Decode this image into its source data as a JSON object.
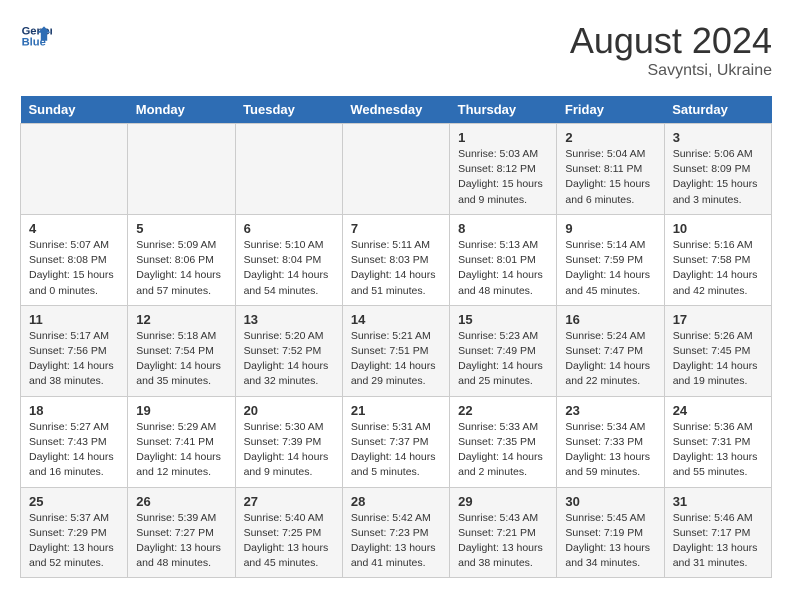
{
  "header": {
    "logo_line1": "General",
    "logo_line2": "Blue",
    "month_year": "August 2024",
    "location": "Savyntsi, Ukraine"
  },
  "weekdays": [
    "Sunday",
    "Monday",
    "Tuesday",
    "Wednesday",
    "Thursday",
    "Friday",
    "Saturday"
  ],
  "weeks": [
    [
      {
        "day": "",
        "info": ""
      },
      {
        "day": "",
        "info": ""
      },
      {
        "day": "",
        "info": ""
      },
      {
        "day": "",
        "info": ""
      },
      {
        "day": "1",
        "info": "Sunrise: 5:03 AM\nSunset: 8:12 PM\nDaylight: 15 hours\nand 9 minutes."
      },
      {
        "day": "2",
        "info": "Sunrise: 5:04 AM\nSunset: 8:11 PM\nDaylight: 15 hours\nand 6 minutes."
      },
      {
        "day": "3",
        "info": "Sunrise: 5:06 AM\nSunset: 8:09 PM\nDaylight: 15 hours\nand 3 minutes."
      }
    ],
    [
      {
        "day": "4",
        "info": "Sunrise: 5:07 AM\nSunset: 8:08 PM\nDaylight: 15 hours\nand 0 minutes."
      },
      {
        "day": "5",
        "info": "Sunrise: 5:09 AM\nSunset: 8:06 PM\nDaylight: 14 hours\nand 57 minutes."
      },
      {
        "day": "6",
        "info": "Sunrise: 5:10 AM\nSunset: 8:04 PM\nDaylight: 14 hours\nand 54 minutes."
      },
      {
        "day": "7",
        "info": "Sunrise: 5:11 AM\nSunset: 8:03 PM\nDaylight: 14 hours\nand 51 minutes."
      },
      {
        "day": "8",
        "info": "Sunrise: 5:13 AM\nSunset: 8:01 PM\nDaylight: 14 hours\nand 48 minutes."
      },
      {
        "day": "9",
        "info": "Sunrise: 5:14 AM\nSunset: 7:59 PM\nDaylight: 14 hours\nand 45 minutes."
      },
      {
        "day": "10",
        "info": "Sunrise: 5:16 AM\nSunset: 7:58 PM\nDaylight: 14 hours\nand 42 minutes."
      }
    ],
    [
      {
        "day": "11",
        "info": "Sunrise: 5:17 AM\nSunset: 7:56 PM\nDaylight: 14 hours\nand 38 minutes."
      },
      {
        "day": "12",
        "info": "Sunrise: 5:18 AM\nSunset: 7:54 PM\nDaylight: 14 hours\nand 35 minutes."
      },
      {
        "day": "13",
        "info": "Sunrise: 5:20 AM\nSunset: 7:52 PM\nDaylight: 14 hours\nand 32 minutes."
      },
      {
        "day": "14",
        "info": "Sunrise: 5:21 AM\nSunset: 7:51 PM\nDaylight: 14 hours\nand 29 minutes."
      },
      {
        "day": "15",
        "info": "Sunrise: 5:23 AM\nSunset: 7:49 PM\nDaylight: 14 hours\nand 25 minutes."
      },
      {
        "day": "16",
        "info": "Sunrise: 5:24 AM\nSunset: 7:47 PM\nDaylight: 14 hours\nand 22 minutes."
      },
      {
        "day": "17",
        "info": "Sunrise: 5:26 AM\nSunset: 7:45 PM\nDaylight: 14 hours\nand 19 minutes."
      }
    ],
    [
      {
        "day": "18",
        "info": "Sunrise: 5:27 AM\nSunset: 7:43 PM\nDaylight: 14 hours\nand 16 minutes."
      },
      {
        "day": "19",
        "info": "Sunrise: 5:29 AM\nSunset: 7:41 PM\nDaylight: 14 hours\nand 12 minutes."
      },
      {
        "day": "20",
        "info": "Sunrise: 5:30 AM\nSunset: 7:39 PM\nDaylight: 14 hours\nand 9 minutes."
      },
      {
        "day": "21",
        "info": "Sunrise: 5:31 AM\nSunset: 7:37 PM\nDaylight: 14 hours\nand 5 minutes."
      },
      {
        "day": "22",
        "info": "Sunrise: 5:33 AM\nSunset: 7:35 PM\nDaylight: 14 hours\nand 2 minutes."
      },
      {
        "day": "23",
        "info": "Sunrise: 5:34 AM\nSunset: 7:33 PM\nDaylight: 13 hours\nand 59 minutes."
      },
      {
        "day": "24",
        "info": "Sunrise: 5:36 AM\nSunset: 7:31 PM\nDaylight: 13 hours\nand 55 minutes."
      }
    ],
    [
      {
        "day": "25",
        "info": "Sunrise: 5:37 AM\nSunset: 7:29 PM\nDaylight: 13 hours\nand 52 minutes."
      },
      {
        "day": "26",
        "info": "Sunrise: 5:39 AM\nSunset: 7:27 PM\nDaylight: 13 hours\nand 48 minutes."
      },
      {
        "day": "27",
        "info": "Sunrise: 5:40 AM\nSunset: 7:25 PM\nDaylight: 13 hours\nand 45 minutes."
      },
      {
        "day": "28",
        "info": "Sunrise: 5:42 AM\nSunset: 7:23 PM\nDaylight: 13 hours\nand 41 minutes."
      },
      {
        "day": "29",
        "info": "Sunrise: 5:43 AM\nSunset: 7:21 PM\nDaylight: 13 hours\nand 38 minutes."
      },
      {
        "day": "30",
        "info": "Sunrise: 5:45 AM\nSunset: 7:19 PM\nDaylight: 13 hours\nand 34 minutes."
      },
      {
        "day": "31",
        "info": "Sunrise: 5:46 AM\nSunset: 7:17 PM\nDaylight: 13 hours\nand 31 minutes."
      }
    ]
  ]
}
